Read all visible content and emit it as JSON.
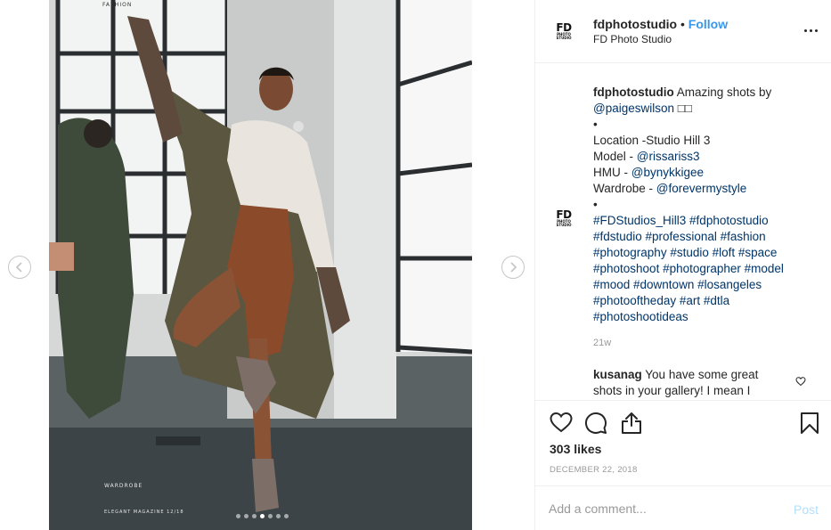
{
  "post": {
    "magazine_section": "FASHION",
    "magazine_wardrobe": "WARDROBE",
    "magazine_issue": "ELEGANT MAGAZINE 12/18",
    "carousel": {
      "total": 7,
      "active_index": 3
    }
  },
  "header": {
    "username": "fdphotostudio",
    "separator": " • ",
    "follow_label": "Follow",
    "full_name": "FD Photo Studio",
    "logo_big": "FD",
    "logo_small": "PHOTO STUDIO"
  },
  "caption": {
    "username": "fdphotostudio",
    "line1": " Amazing shots by",
    "mention_photographer": "@paigeswilson",
    "emoji_placeholder": " □□",
    "bullet1": "•",
    "location": "Location -Studio Hill 3",
    "model_label": "Model - ",
    "model_handle": "@rissariss3",
    "hmu_label": "HMU - ",
    "hmu_handle": "@bynykkigee",
    "wardrobe_label": "Wardrobe - ",
    "wardrobe_handle": "@forevermystyle",
    "bullet2": "•",
    "hashtag_lines": [
      "#FDStudios_Hill3 #fdphotostudio",
      "#fdstudio #professional #fashion",
      "#photography #studio #loft #space",
      "#photoshoot #photographer #model",
      "#mood #downtown #losangeles",
      "#photooftheday #art #dtla",
      "#photoshootideas"
    ],
    "time_ago": "21w"
  },
  "comment": {
    "username": "kusanag",
    "text_line1": " You have some great",
    "text_line2": "shots in your gallery! I mean I"
  },
  "stats": {
    "likes": "303 likes",
    "date": "DECEMBER 22, 2018"
  },
  "comment_form": {
    "placeholder": "Add a comment...",
    "post_label": "Post"
  },
  "colors": {
    "follow": "#3897f0",
    "link": "#003569",
    "muted": "#999999",
    "post_disabled": "#b2dffc"
  }
}
